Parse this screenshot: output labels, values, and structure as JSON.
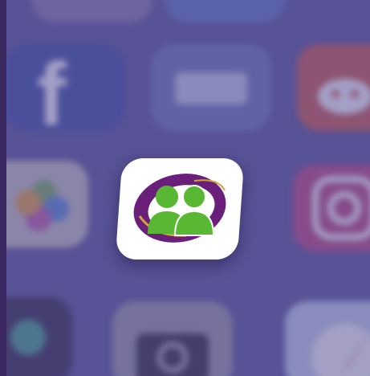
{
  "screen": {
    "background_color": "#5a5597",
    "overlay_color": "#5850961a"
  },
  "background_apps": [
    {
      "name": "facebook",
      "icon": "facebook-f-icon",
      "color": "#3b4fa3"
    },
    {
      "name": "unknown-blue-app",
      "icon": "app-icon",
      "color": "#6a79b8"
    },
    {
      "name": "reddit",
      "icon": "reddit-alien-icon",
      "color": "#d0594a"
    },
    {
      "name": "photos",
      "icon": "photos-flower-icon",
      "color": "#c9c7c1"
    },
    {
      "name": "instagram",
      "icon": "instagram-camera-icon",
      "color": "#c0467f"
    },
    {
      "name": "unknown-dark-app",
      "icon": "app-icon",
      "color": "#2f2b45"
    },
    {
      "name": "camera",
      "icon": "camera-icon",
      "color": "#9b9aa6"
    },
    {
      "name": "safari",
      "icon": "compass-icon",
      "color": "#c8d6ee"
    }
  ],
  "featured_app": {
    "icon": "two-people-icon",
    "tile_color": "#ffffff",
    "ring_color": "#6a1f7a",
    "people_color": "#58b833"
  }
}
